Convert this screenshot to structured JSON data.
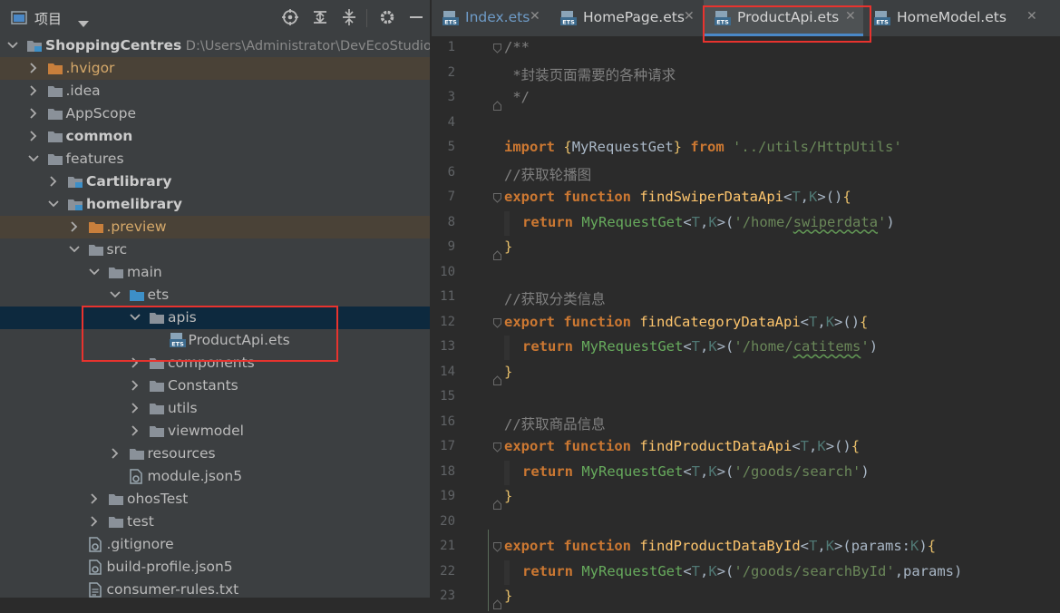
{
  "project_panel": {
    "title": "项目",
    "icons": [
      "locate-icon",
      "expand-all-icon",
      "collapse-all-icon",
      "gear-icon",
      "minimize-icon"
    ]
  },
  "tree": [
    {
      "label": "ShoppingCentres",
      "path": "D:\\Users\\Administrator\\DevEcoStudioPr",
      "indent": 0,
      "expanded": true,
      "icon": "module",
      "bold": true
    },
    {
      "label": ".hvigor",
      "indent": 1,
      "expanded": false,
      "icon": "folder-orange",
      "highlight": "orange"
    },
    {
      "label": ".idea",
      "indent": 1,
      "expanded": false,
      "icon": "folder"
    },
    {
      "label": "AppScope",
      "indent": 1,
      "expanded": false,
      "icon": "folder"
    },
    {
      "label": "common",
      "indent": 1,
      "expanded": false,
      "icon": "folder",
      "bold": true
    },
    {
      "label": "features",
      "indent": 1,
      "expanded": true,
      "icon": "folder"
    },
    {
      "label": "Cartlibrary",
      "indent": 2,
      "expanded": false,
      "icon": "module",
      "bold": true
    },
    {
      "label": "homelibrary",
      "indent": 2,
      "expanded": true,
      "icon": "module",
      "bold": true
    },
    {
      "label": ".preview",
      "indent": 3,
      "expanded": false,
      "icon": "folder-orange",
      "highlight": "orange"
    },
    {
      "label": "src",
      "indent": 3,
      "expanded": true,
      "icon": "folder"
    },
    {
      "label": "main",
      "indent": 4,
      "expanded": true,
      "icon": "folder"
    },
    {
      "label": "ets",
      "indent": 5,
      "expanded": true,
      "icon": "folder-blue"
    },
    {
      "label": "apis",
      "indent": 6,
      "expanded": true,
      "icon": "folder",
      "highlight": "blue"
    },
    {
      "label": "ProductApi.ets",
      "indent": 7,
      "icon": "ets-file"
    },
    {
      "label": "components",
      "indent": 6,
      "expanded": false,
      "icon": "folder"
    },
    {
      "label": "Constants",
      "indent": 6,
      "expanded": false,
      "icon": "folder"
    },
    {
      "label": "utils",
      "indent": 6,
      "expanded": false,
      "icon": "folder"
    },
    {
      "label": "viewmodel",
      "indent": 6,
      "expanded": false,
      "icon": "folder"
    },
    {
      "label": "resources",
      "indent": 5,
      "expanded": false,
      "icon": "folder"
    },
    {
      "label": "module.json5",
      "indent": 5,
      "icon": "config-file"
    },
    {
      "label": "ohosTest",
      "indent": 4,
      "expanded": false,
      "icon": "folder"
    },
    {
      "label": "test",
      "indent": 4,
      "expanded": false,
      "icon": "folder"
    },
    {
      "label": ".gitignore",
      "indent": 3,
      "icon": "config-file"
    },
    {
      "label": "build-profile.json5",
      "indent": 3,
      "icon": "config-file"
    },
    {
      "label": "consumer-rules.txt",
      "indent": 3,
      "icon": "text-file"
    }
  ],
  "tabs": [
    {
      "label": "Index.ets",
      "active": false
    },
    {
      "label": "HomePage.ets",
      "active": false
    },
    {
      "label": "ProductApi.ets",
      "active": true
    },
    {
      "label": "HomeModel.ets",
      "active": false
    }
  ],
  "code": [
    {
      "n": "1",
      "tokens": [
        [
          "cm",
          "/**"
        ]
      ],
      "fold": "top"
    },
    {
      "n": "2",
      "tokens": [
        [
          "cm",
          " *封装页面需要的各种请求"
        ]
      ]
    },
    {
      "n": "3",
      "tokens": [
        [
          "cm",
          " */"
        ]
      ],
      "fold": "bottom"
    },
    {
      "n": "4",
      "tokens": []
    },
    {
      "n": "5",
      "tokens": [
        [
          "kw",
          "import"
        ],
        [
          "imp",
          " "
        ],
        [
          "br",
          "{"
        ],
        [
          "imp",
          "MyRequestGet"
        ],
        [
          "br",
          "}"
        ],
        [
          "imp",
          " "
        ],
        [
          "kw",
          "from"
        ],
        [
          "imp",
          " "
        ],
        [
          "str",
          "'../utils/HttpUtils'"
        ]
      ]
    },
    {
      "n": "6",
      "tokens": [
        [
          "cm",
          "//获取轮播图"
        ]
      ]
    },
    {
      "n": "7",
      "tokens": [
        [
          "kw",
          "export"
        ],
        [
          "imp",
          " "
        ],
        [
          "kw",
          "function"
        ],
        [
          "imp",
          " "
        ],
        [
          "fn",
          "findSwiperDataApi"
        ],
        [
          "imp",
          "<"
        ],
        [
          "tp",
          "T"
        ],
        [
          "imp",
          ","
        ],
        [
          "tp",
          "K"
        ],
        [
          "imp",
          ">()"
        ],
        [
          "br",
          "{"
        ]
      ],
      "fold": "top"
    },
    {
      "n": "8",
      "tokens": [
        [
          "kw",
          "return"
        ],
        [
          "imp",
          " "
        ],
        [
          "call",
          "MyRequestGet"
        ],
        [
          "imp",
          "<"
        ],
        [
          "tp",
          "T"
        ],
        [
          "imp",
          ","
        ],
        [
          "tp",
          "K"
        ],
        [
          "imp",
          ">("
        ],
        [
          "str",
          "'/home/"
        ],
        [
          "str sq",
          "swiperdata"
        ],
        [
          "str",
          "'"
        ],
        [
          "imp",
          ")"
        ]
      ],
      "indent": true
    },
    {
      "n": "9",
      "tokens": [
        [
          "br",
          "}"
        ]
      ],
      "fold": "bottom"
    },
    {
      "n": "10",
      "tokens": []
    },
    {
      "n": "11",
      "tokens": [
        [
          "cm",
          "//获取分类信息"
        ]
      ]
    },
    {
      "n": "12",
      "tokens": [
        [
          "kw",
          "export"
        ],
        [
          "imp",
          " "
        ],
        [
          "kw",
          "function"
        ],
        [
          "imp",
          " "
        ],
        [
          "fn",
          "findCategoryDataApi"
        ],
        [
          "imp",
          "<"
        ],
        [
          "tp",
          "T"
        ],
        [
          "imp",
          ","
        ],
        [
          "tp",
          "K"
        ],
        [
          "imp",
          ">()"
        ],
        [
          "br",
          "{"
        ]
      ],
      "fold": "top"
    },
    {
      "n": "13",
      "tokens": [
        [
          "kw",
          "return"
        ],
        [
          "imp",
          " "
        ],
        [
          "call",
          "MyRequestGet"
        ],
        [
          "imp",
          "<"
        ],
        [
          "tp",
          "T"
        ],
        [
          "imp",
          ","
        ],
        [
          "tp",
          "K"
        ],
        [
          "imp",
          ">("
        ],
        [
          "str",
          "'/home/"
        ],
        [
          "str sq",
          "catitems"
        ],
        [
          "str",
          "'"
        ],
        [
          "imp",
          ")"
        ]
      ],
      "indent": true
    },
    {
      "n": "14",
      "tokens": [
        [
          "br",
          "}"
        ]
      ],
      "fold": "bottom"
    },
    {
      "n": "15",
      "tokens": []
    },
    {
      "n": "16",
      "tokens": [
        [
          "cm",
          "//获取商品信息"
        ]
      ]
    },
    {
      "n": "17",
      "tokens": [
        [
          "kw",
          "export"
        ],
        [
          "imp",
          " "
        ],
        [
          "kw",
          "function"
        ],
        [
          "imp",
          " "
        ],
        [
          "fn",
          "findProductDataApi"
        ],
        [
          "imp",
          "<"
        ],
        [
          "tp",
          "T"
        ],
        [
          "imp",
          ","
        ],
        [
          "tp",
          "K"
        ],
        [
          "imp",
          ">()"
        ],
        [
          "br",
          "{"
        ]
      ],
      "fold": "top"
    },
    {
      "n": "18",
      "tokens": [
        [
          "kw",
          "return"
        ],
        [
          "imp",
          " "
        ],
        [
          "call",
          "MyRequestGet"
        ],
        [
          "imp",
          "<"
        ],
        [
          "tp",
          "T"
        ],
        [
          "imp",
          ","
        ],
        [
          "tp",
          "K"
        ],
        [
          "imp",
          ">("
        ],
        [
          "str",
          "'/goods/search'"
        ],
        [
          "imp",
          ")"
        ]
      ],
      "indent": true
    },
    {
      "n": "19",
      "tokens": [
        [
          "br",
          "}"
        ]
      ],
      "fold": "bottom"
    },
    {
      "n": "20",
      "tokens": []
    },
    {
      "n": "21",
      "tokens": [
        [
          "kw",
          "export"
        ],
        [
          "imp",
          " "
        ],
        [
          "kw",
          "function"
        ],
        [
          "imp",
          " "
        ],
        [
          "fn",
          "findProductDataById"
        ],
        [
          "imp",
          "<"
        ],
        [
          "tp",
          "T"
        ],
        [
          "imp",
          ","
        ],
        [
          "tp",
          "K"
        ],
        [
          "imp",
          ">(params:"
        ],
        [
          "tp",
          "K"
        ],
        [
          "imp",
          ")"
        ],
        [
          "br",
          "{"
        ]
      ],
      "fold": "top"
    },
    {
      "n": "22",
      "tokens": [
        [
          "kw",
          "return"
        ],
        [
          "imp",
          " "
        ],
        [
          "call",
          "MyRequestGet"
        ],
        [
          "imp",
          "<"
        ],
        [
          "tp",
          "T"
        ],
        [
          "imp",
          ","
        ],
        [
          "tp",
          "K"
        ],
        [
          "imp",
          ">("
        ],
        [
          "str",
          "'/goods/searchById'"
        ],
        [
          "imp",
          ",params)"
        ]
      ],
      "indent": true
    },
    {
      "n": "23",
      "tokens": [
        [
          "br",
          "}"
        ]
      ],
      "fold": "bottom"
    }
  ],
  "colors": {
    "accent": "#4a88c7",
    "annotation_red": "#e8332e",
    "folder": "#8a9199",
    "folder_orange": "#c87f3c",
    "folder_blue": "#3d8fc7"
  }
}
